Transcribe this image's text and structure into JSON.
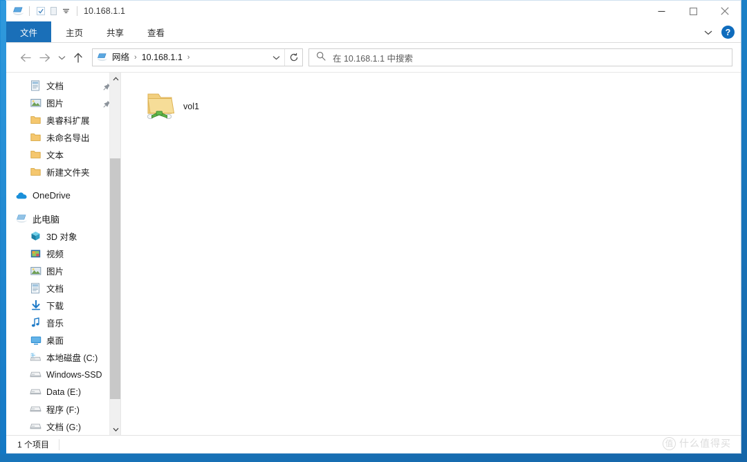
{
  "window": {
    "title": "10.168.1.1",
    "accent_color": "#1a6fb8",
    "titlebar_icons": {
      "app": "network-computer-icon",
      "properties": "properties-checkbox-icon",
      "new_folder": "new-folder-icon",
      "qat_dropdown": "customize-quick-access-toolbar-icon"
    },
    "caption": {
      "minimize": "minimize-icon",
      "maximize": "maximize-icon",
      "close": "close-icon"
    }
  },
  "ribbon": {
    "tabs": [
      {
        "label": "文件",
        "active": true
      },
      {
        "label": "主页",
        "active": false
      },
      {
        "label": "共享",
        "active": false
      },
      {
        "label": "查看",
        "active": false
      }
    ],
    "expand_icon": "chevron-down-icon",
    "help_label": "?"
  },
  "navigation": {
    "back_title": "后退",
    "forward_title": "前进",
    "recent_title": "最近浏览的位置",
    "up_title": "上移到",
    "breadcrumb": {
      "icon": "network-computer-icon",
      "parts": [
        "网络",
        "10.168.1.1"
      ],
      "separator": "›"
    },
    "address_dropdown_icon": "chevron-down-icon",
    "refresh_icon": "refresh-icon"
  },
  "search": {
    "icon": "search-icon",
    "placeholder": "在 10.168.1.1 中搜索"
  },
  "sidebar": {
    "groups": [
      {
        "items": [
          {
            "label": "文档",
            "icon": "document-icon",
            "pinned": true,
            "indent": 1
          },
          {
            "label": "图片",
            "icon": "picture-icon",
            "pinned": true,
            "indent": 1
          },
          {
            "label": "奥睿科扩展",
            "icon": "folder-icon",
            "pinned": false,
            "indent": 1
          },
          {
            "label": "未命名导出",
            "icon": "folder-icon",
            "pinned": false,
            "indent": 1
          },
          {
            "label": "文本",
            "icon": "folder-icon",
            "pinned": false,
            "indent": 1
          },
          {
            "label": "新建文件夹",
            "icon": "folder-icon",
            "pinned": false,
            "indent": 1
          }
        ]
      },
      {
        "items": [
          {
            "label": "OneDrive",
            "icon": "onedrive-cloud-icon",
            "pinned": false,
            "indent": 0
          }
        ]
      },
      {
        "items": [
          {
            "label": "此电脑",
            "icon": "this-pc-icon",
            "pinned": false,
            "indent": 0
          },
          {
            "label": "3D 对象",
            "icon": "3d-objects-icon",
            "pinned": false,
            "indent": 1
          },
          {
            "label": "视频",
            "icon": "videos-icon",
            "pinned": false,
            "indent": 1
          },
          {
            "label": "图片",
            "icon": "picture-icon",
            "pinned": false,
            "indent": 1
          },
          {
            "label": "文档",
            "icon": "document-icon",
            "pinned": false,
            "indent": 1
          },
          {
            "label": "下载",
            "icon": "downloads-arrow-icon",
            "pinned": false,
            "indent": 1
          },
          {
            "label": "音乐",
            "icon": "music-note-icon",
            "pinned": false,
            "indent": 1
          },
          {
            "label": "桌面",
            "icon": "desktop-icon",
            "pinned": false,
            "indent": 1
          },
          {
            "label": "本地磁盘 (C:)",
            "icon": "windows-drive-icon",
            "pinned": false,
            "indent": 1
          },
          {
            "label": "Windows-SSD",
            "icon": "drive-icon",
            "pinned": false,
            "indent": 1
          },
          {
            "label": "Data (E:)",
            "icon": "drive-icon",
            "pinned": false,
            "indent": 1
          },
          {
            "label": "程序 (F:)",
            "icon": "drive-icon",
            "pinned": false,
            "indent": 1
          },
          {
            "label": "文档 (G:)",
            "icon": "drive-icon",
            "pinned": false,
            "indent": 1
          }
        ]
      }
    ],
    "scrollbar": {
      "up_icon": "chevron-up-icon",
      "down_icon": "chevron-down-icon"
    }
  },
  "content": {
    "items": [
      {
        "label": "vol1",
        "icon": "shared-folder-icon"
      }
    ]
  },
  "statusbar": {
    "item_count_text": "1 个项目"
  },
  "watermark": {
    "badge": "值",
    "text": "什么值得买"
  }
}
